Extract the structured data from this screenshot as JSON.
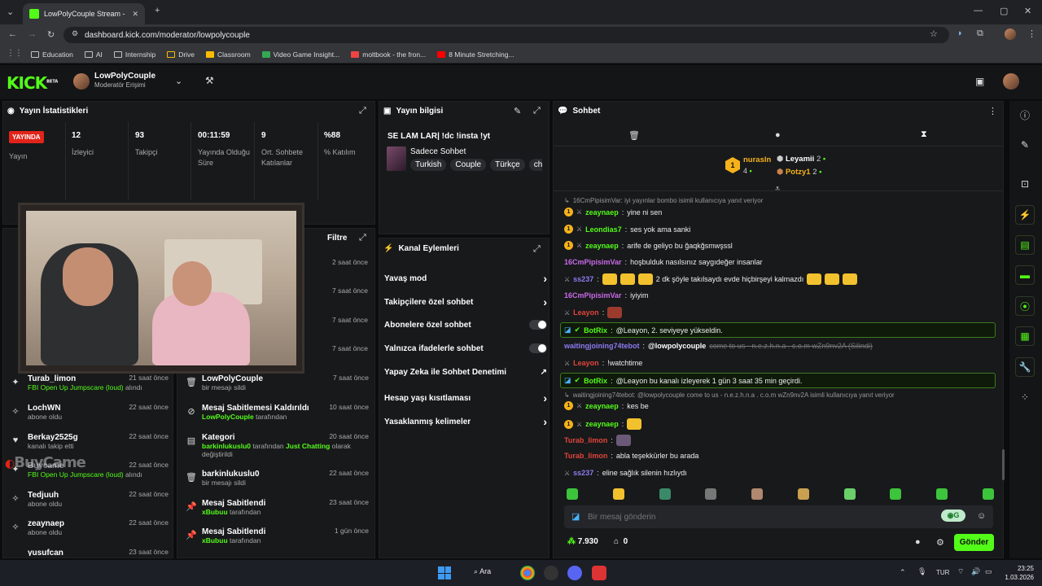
{
  "browser": {
    "tab_title": "LowPolyCouple Stream - Kick D",
    "url": "dashboard.kick.com/moderator/lowpolycouple",
    "bookmarks": [
      "Education",
      "AI",
      "Internship",
      "Drive",
      "Classroom",
      "Video Game Insight...",
      "moltbook - the fron...",
      "8 Minute Stretching..."
    ]
  },
  "header": {
    "logo": "KICK",
    "logo_beta": "BETA",
    "channel": "LowPolyCouple",
    "role": "Moderatör Erişimi"
  },
  "stats": {
    "title": "Yayın İstatistikleri",
    "live_badge": "YAYINDA",
    "live_label": "Yayın",
    "items": [
      {
        "value": "12",
        "label": "İzleyici"
      },
      {
        "value": "93",
        "label": "Takipçi"
      },
      {
        "value": "00:11:59",
        "label": "Yayında Olduğu Süre"
      },
      {
        "value": "9",
        "label": "Ort. Sohbete Katılanlar"
      },
      {
        "value": "%88",
        "label": "% Katılım"
      }
    ]
  },
  "activity_left": {
    "filter": "Filtre",
    "times_top": [
      "2 saat önce",
      "7 saat önce",
      "7 saat önce",
      "7 saat önce"
    ],
    "events": [
      {
        "name": "Turab_limon",
        "sub_green": "FBI Open Up Jumpscare (loud)",
        "sub": "alındı",
        "time": "21 saat önce"
      },
      {
        "name": "LochWN",
        "sub_green": "",
        "sub": "abone oldu",
        "time": "22 saat önce"
      },
      {
        "name": "Berkay2525g",
        "sub_green": "",
        "sub": "kanalı takip etti",
        "time": "22 saat önce"
      },
      {
        "name": "Buycame",
        "sub_green": "FBI Open Up Jumpscare (loud)",
        "sub": "alındı",
        "time": "22 saat önce"
      },
      {
        "name": "Tedjuuh",
        "sub_green": "",
        "sub": "abone oldu",
        "time": "22 saat önce"
      },
      {
        "name": "zeaynaep",
        "sub_green": "",
        "sub": "abone oldu",
        "time": "22 saat önce"
      },
      {
        "name": "yusufcan",
        "sub_green": "",
        "sub": "",
        "time": "23 saat önce"
      }
    ]
  },
  "activity_mid": {
    "events": [
      {
        "name": "LowPolyCouple",
        "green": "",
        "sub": "bir mesajı sildi",
        "time": "7 saat önce"
      },
      {
        "name": "Mesaj Sabitlemesi Kaldırıldı",
        "green": "LowPolyCouple",
        "sub": "tarafından",
        "time": "10 saat önce"
      },
      {
        "name": "Kategori",
        "green": "barkinlukuslu0",
        "sub": "tarafından",
        "green2": "Just Chatting",
        "sub2": "olarak değiştirildi",
        "time": "20 saat önce"
      },
      {
        "name": "barkinlukuslu0",
        "green": "",
        "sub": "bir mesajı sildi",
        "time": "22 saat önce"
      },
      {
        "name": "Mesaj Sabitlendi",
        "green": "xBubuu",
        "sub": "tarafından",
        "time": "23 saat önce"
      },
      {
        "name": "Mesaj Sabitlendi",
        "green": "xBubuu",
        "sub": "tarafından",
        "time": "1 gün önce"
      }
    ]
  },
  "stream_info": {
    "title": "Yayın bilgisi",
    "stream_title": "SE LAM LAR| !dc !insta !yt",
    "category": "Sadece Sohbet",
    "tags": [
      "Turkish",
      "Couple",
      "Türkçe",
      "chil"
    ]
  },
  "channel_actions": {
    "title": "Kanal Eylemleri",
    "items": [
      {
        "label": "Yavaş mod",
        "control": "chevron"
      },
      {
        "label": "Takipçilere özel sohbet",
        "control": "chevron"
      },
      {
        "label": "Abonelere özel sohbet",
        "control": "toggle"
      },
      {
        "label": "Yalnızca ifadelerle sohbet",
        "control": "toggle"
      },
      {
        "label": "Yapay Zeka ile Sohbet Denetimi",
        "control": "external"
      },
      {
        "label": "Hesap yaşı kısıtlaması",
        "control": "chevron"
      },
      {
        "label": "Yasaklanmış kelimeler",
        "control": "chevron"
      }
    ]
  },
  "chat": {
    "title": "Sohbet",
    "leaders": [
      {
        "name": "nurasln",
        "count": "4"
      },
      {
        "name": "Leyamii",
        "count": "2"
      },
      {
        "name": "Potzy1",
        "count": "2"
      }
    ],
    "reply1": "16CmPipisimVar: iyi yayınlar bombo isimli kullanıcıya yanıt veriyor",
    "messages": [
      {
        "user": "zeaynaep",
        "color": "#53fc18",
        "text": "yine ni sen",
        "badge": true
      },
      {
        "user": "Leondias7",
        "color": "#53fc18",
        "text": "ses yok ama sanki",
        "badge": true
      },
      {
        "user": "zeaynaep",
        "color": "#53fc18",
        "text": "arife de geliyo bu ğaqkğsmwşssl",
        "badge": true
      },
      {
        "user": "16CmPipisimVar",
        "color": "#c86ae8",
        "text": "hoşbulduk nasılsınız saygıdeğer insanlar",
        "badge": false
      },
      {
        "user": "ss237",
        "color": "#8a7cf0",
        "text": "2 dk şöyle takılsaydı evde hiçbirşeyi kalmazdı",
        "badge": false
      },
      {
        "user": "16CmPipisimVar",
        "color": "#c86ae8",
        "text": "iyiyim",
        "badge": false
      },
      {
        "user": "Leayon",
        "color": "#e0453a",
        "text": "",
        "badge": false
      }
    ],
    "bot1": {
      "user": "BotRix",
      "text": "@Leayon, 2. seviyeye yükseldin."
    },
    "waiting": {
      "user": "waitingjoining74tebot",
      "mention": "@lowpolycouple",
      "text": "come to us - n.e.z.h.n.a . c.o.m wZn9nv2A (Silindi)"
    },
    "leayon2": {
      "user": "Leayon",
      "text": "!watchtime"
    },
    "bot2": {
      "user": "BotRix",
      "text": "@Leayon bu kanalı izleyerek 1 gün 3 saat 35 min geçirdi."
    },
    "reply2": "waitingjoining74tebot: @lowpolycouple come to us - n.e.z.h.n.a . c.o.m wZn9nv2A isimli kullanıcıya yanıt veriyor",
    "messages2": [
      {
        "user": "zeaynaep",
        "color": "#53fc18",
        "text": "kes be",
        "badge": true
      },
      {
        "user": "zeaynaep",
        "color": "#53fc18",
        "text": "",
        "badge": true
      },
      {
        "user": "Turab_limon",
        "color": "#e0453a",
        "text": "",
        "badge": false
      },
      {
        "user": "Turab_limon",
        "color": "#e0453a",
        "text": "abla teşekkürler bu arada",
        "badge": false
      },
      {
        "user": "ss237",
        "color": "#8a7cf0",
        "text": "eline sağlık silenin hızlıydı",
        "badge": false
      }
    ],
    "input_placeholder": "Bir mesaj gönderin",
    "points": "7.930",
    "other_count": "0",
    "send": "Gönder"
  },
  "overlay": {
    "watermark": "BuyCame"
  },
  "taskbar": {
    "search": "Ara",
    "lang": "TUR",
    "time": "23:25",
    "date": "1.03.2026"
  }
}
